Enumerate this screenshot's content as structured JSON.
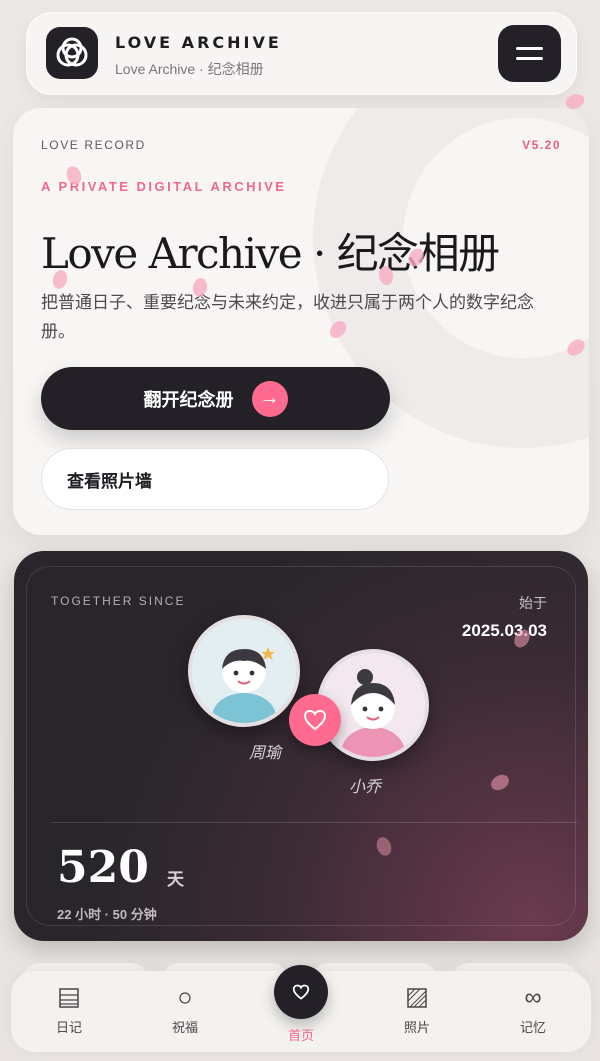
{
  "header": {
    "brand_title": "LOVE ARCHIVE",
    "brand_subtitle": "Love Archive · 纪念相册",
    "logo_icon": "interlocking-rings-icon",
    "menu_icon": "hamburger-menu-icon"
  },
  "hero": {
    "tag": "LOVE RECORD",
    "version": "V5.20",
    "kicker": "A PRIVATE DIGITAL ARCHIVE",
    "title": "Love Archive · 纪念相册",
    "description": "把普通日子、重要纪念与未来约定，收进只属于两个人的数字纪念册。",
    "primary_button": "翻开纪念册",
    "primary_arrow": "→",
    "secondary_button": "查看照片墙"
  },
  "together": {
    "tag": "TOGETHER SINCE",
    "since_label": "始于",
    "date": "2025.03.03",
    "person_a": "周瑜",
    "person_b": "小乔",
    "days": "520",
    "days_unit": "天",
    "duration": "22 小时 · 50 分钟"
  },
  "nav": {
    "items": [
      {
        "label": "日记",
        "icon": "diary-icon"
      },
      {
        "label": "祝福",
        "icon": "blessing-icon"
      },
      {
        "label": "首页",
        "icon": "heart-icon"
      },
      {
        "label": "照片",
        "icon": "photo-icon"
      },
      {
        "label": "记忆",
        "icon": "infinity-icon"
      }
    ],
    "active": "首页"
  },
  "colors": {
    "accent_pink": "#ff6b8f",
    "dark": "#232127",
    "background": "#ece8e5"
  }
}
